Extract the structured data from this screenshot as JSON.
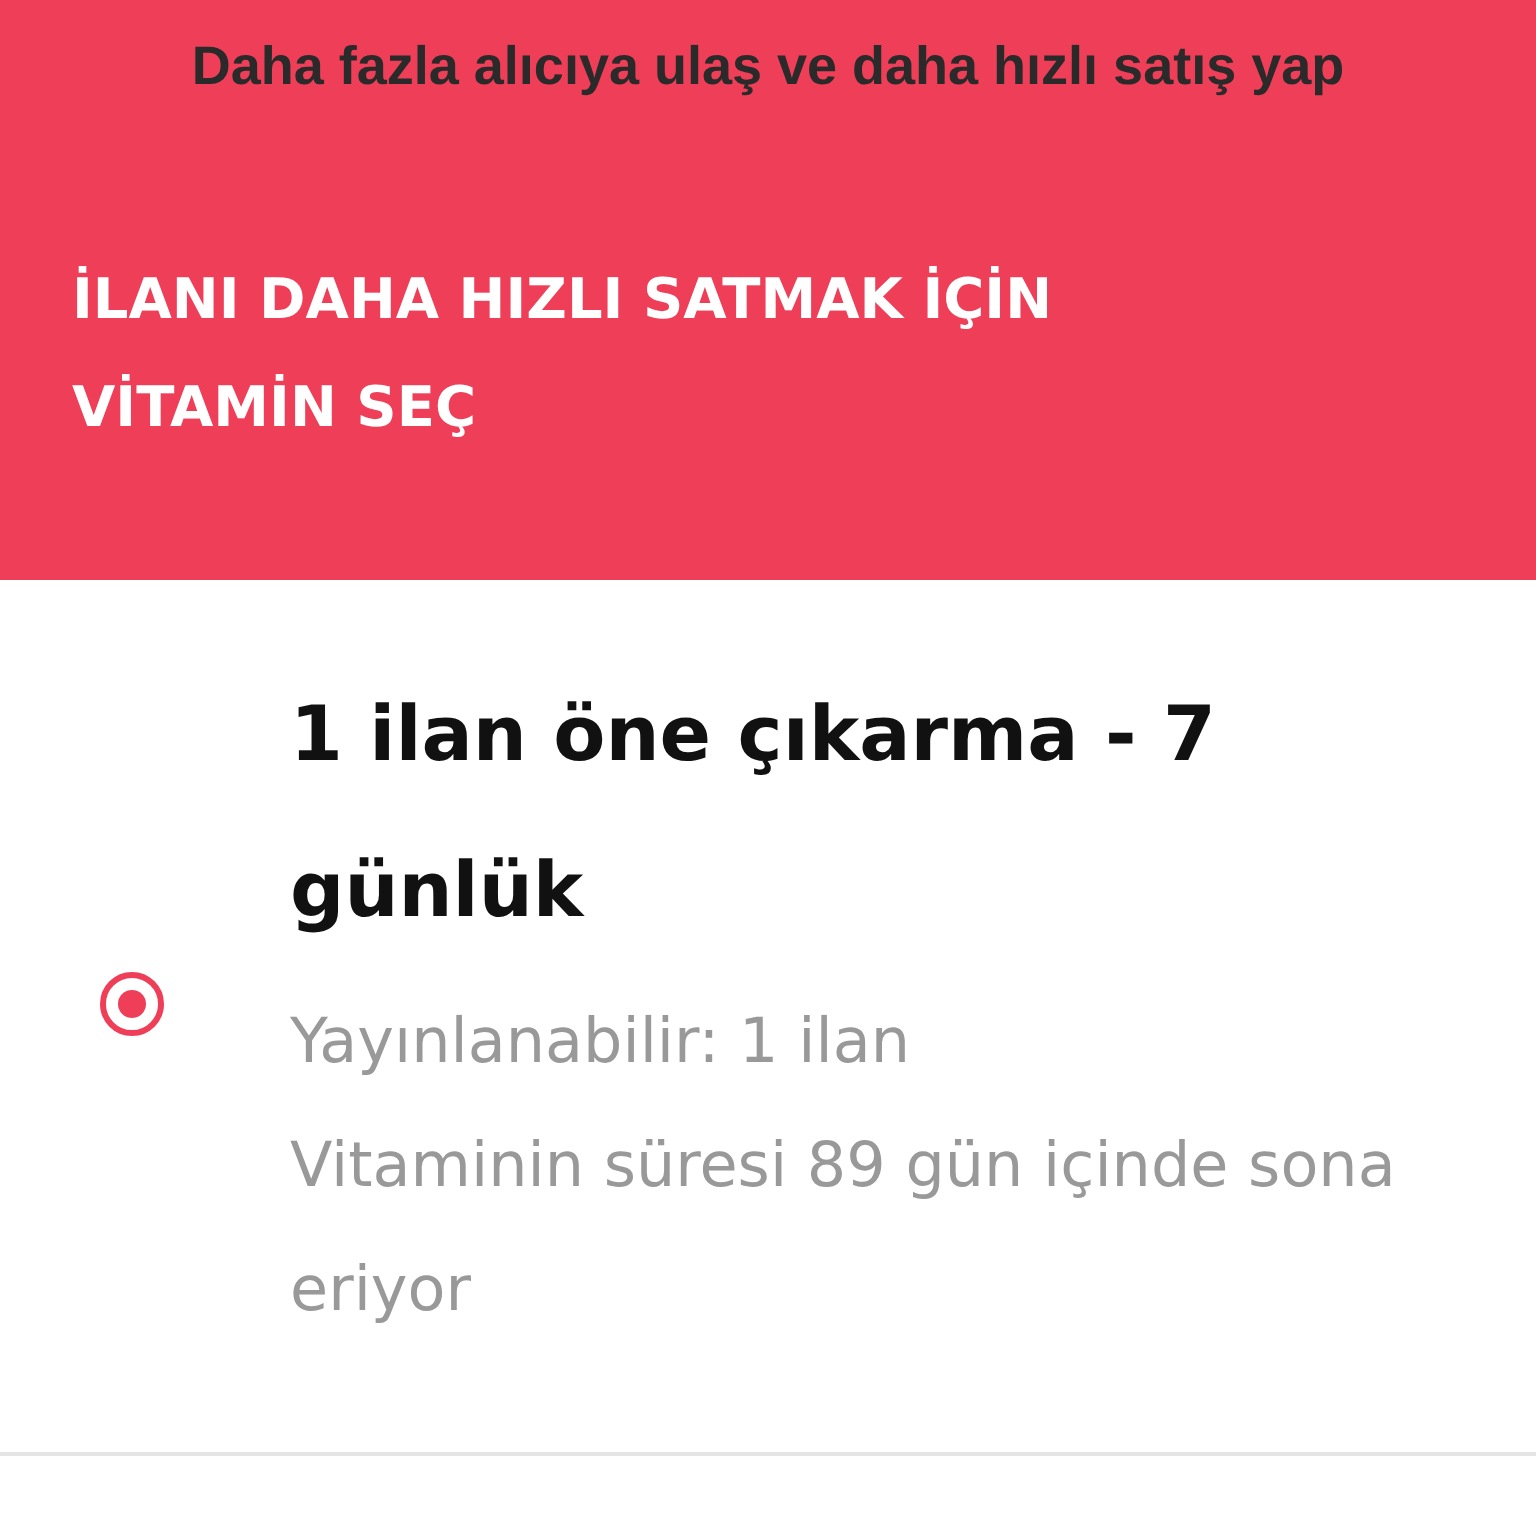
{
  "banner": {
    "title": "Daha fazla alıcıya ulaş ve daha hızlı satış yap",
    "heading": "İLANI DAHA HIZLI SATMAK İÇİN VİTAMİN SEÇ"
  },
  "options": [
    {
      "title": "1 ilan öne çıkarma - 7 günlük",
      "details": [
        "Yayınlanabilir: 1 ilan",
        "Vitaminin süresi 89 gün içinde sona eriyor"
      ],
      "selected": true
    }
  ]
}
